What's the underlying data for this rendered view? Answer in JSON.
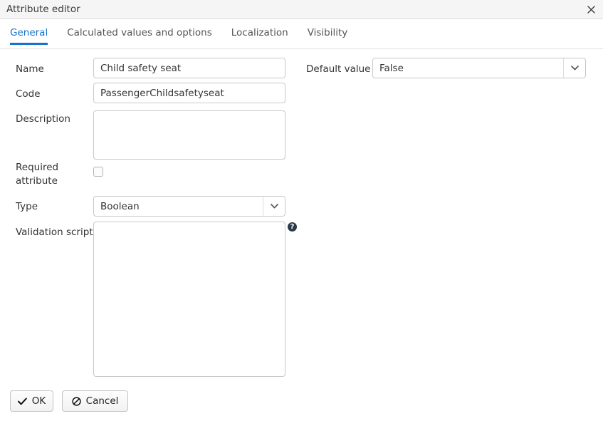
{
  "window": {
    "title": "Attribute editor",
    "close_icon": "close-icon"
  },
  "tabs": [
    {
      "label": "General",
      "active": true
    },
    {
      "label": "Calculated values and options",
      "active": false
    },
    {
      "label": "Localization",
      "active": false
    },
    {
      "label": "Visibility",
      "active": false
    }
  ],
  "form": {
    "name": {
      "label": "Name",
      "value": "Child safety seat",
      "placeholder": ""
    },
    "code": {
      "label": "Code",
      "value": "PassengerChildsafetyseat",
      "placeholder": ""
    },
    "description": {
      "label": "Description",
      "value": "",
      "placeholder": ""
    },
    "required_attribute": {
      "label": "Required attribute",
      "checked": false
    },
    "type": {
      "label": "Type",
      "value": "Boolean"
    },
    "validation_script": {
      "label": "Validation script",
      "value": "",
      "placeholder": "",
      "help_icon": "help-icon"
    },
    "default_value": {
      "label": "Default value",
      "value": "False"
    }
  },
  "footer": {
    "ok_label": "OK",
    "cancel_label": "Cancel",
    "ok_icon": "check-icon",
    "cancel_icon": "ban-icon"
  },
  "colors": {
    "accent": "#1673c8",
    "text": "#333333",
    "border": "#c8c8c8",
    "titlebar_bg": "#f5f5f5"
  }
}
